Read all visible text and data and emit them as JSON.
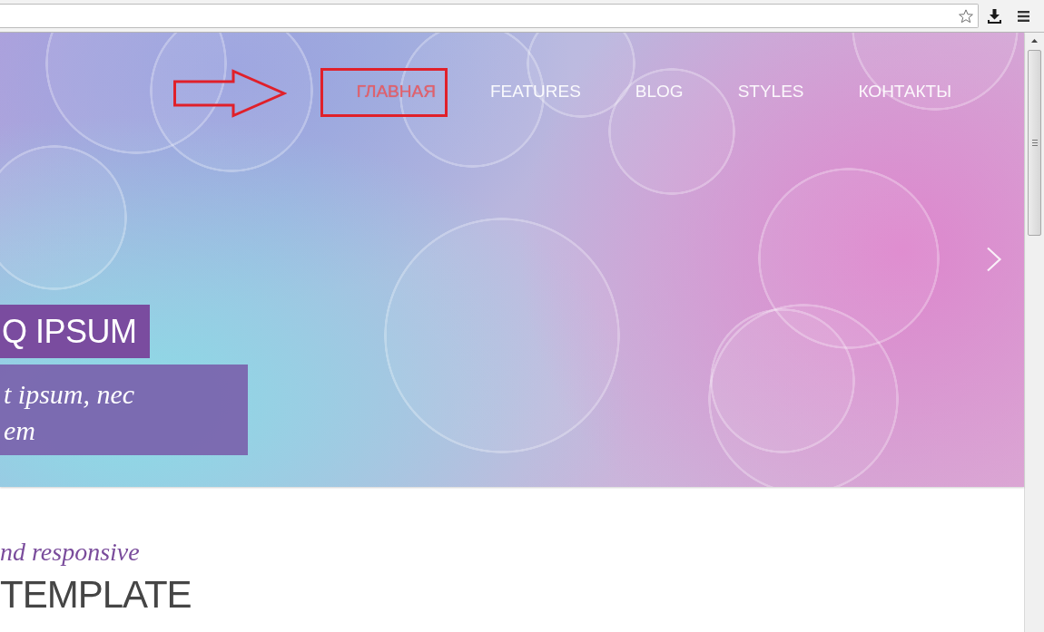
{
  "nav": {
    "items": [
      {
        "label": "ГЛАВНАЯ",
        "selected": true,
        "highlighted": true
      },
      {
        "label": "FEATURES",
        "selected": false,
        "highlighted": false
      },
      {
        "label": "BLOG",
        "selected": false,
        "highlighted": false
      },
      {
        "label": "STYLES",
        "selected": false,
        "highlighted": false
      },
      {
        "label": "КОНТАКТЫ",
        "selected": false,
        "highlighted": false
      }
    ]
  },
  "hero": {
    "title": "Q IPSUM",
    "subtitle": "t ipsum, nec\nem"
  },
  "intro": {
    "tagline": "nd responsive",
    "heading": "TEMPLATE"
  }
}
